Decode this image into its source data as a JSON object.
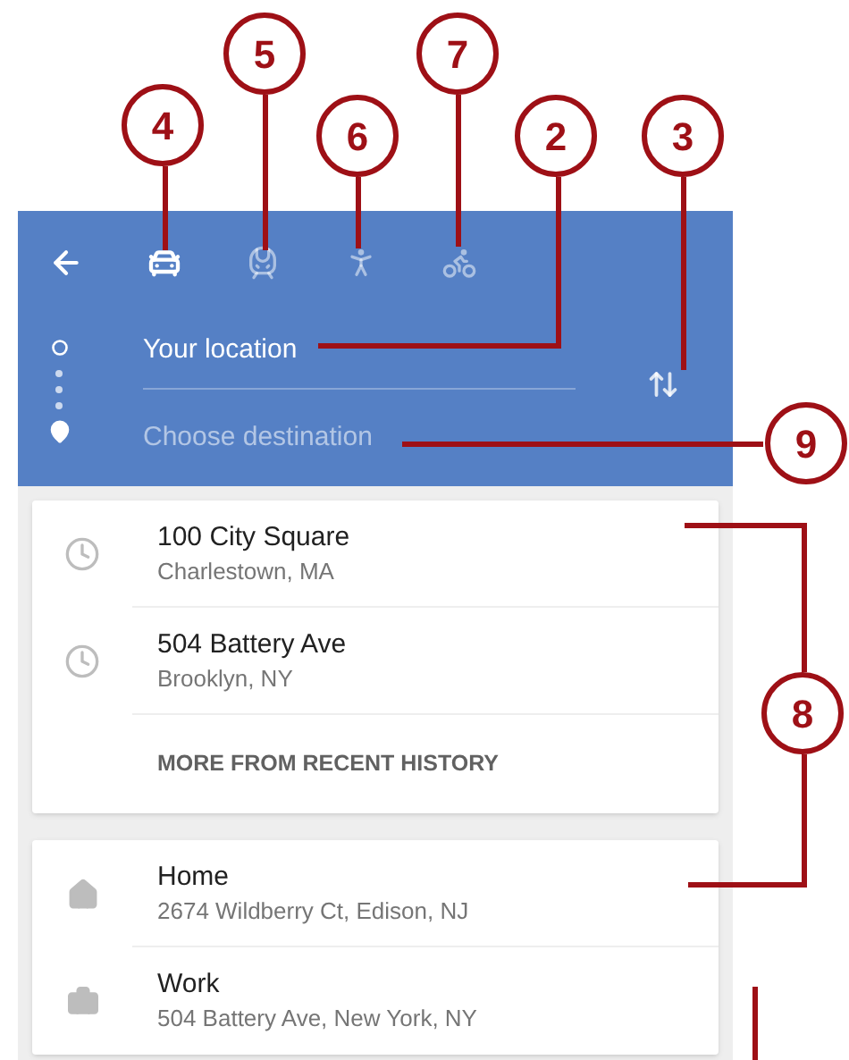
{
  "header": {
    "modes": [
      {
        "kind": "car",
        "selected": true
      },
      {
        "kind": "transit",
        "selected": false
      },
      {
        "kind": "walk",
        "selected": false
      },
      {
        "kind": "bike",
        "selected": false
      }
    ],
    "origin": "Your location",
    "destination": {
      "placeholder": "Choose destination"
    }
  },
  "recent": [
    {
      "title": "100 City Square",
      "subtitle": "Charlestown, MA"
    },
    {
      "title": "504 Battery Ave",
      "subtitle": "Brooklyn, NY"
    }
  ],
  "more_link": "MORE FROM RECENT HISTORY",
  "saved": [
    {
      "kind": "home",
      "title": "Home",
      "subtitle": "2674 Wildberry Ct, Edison, NJ"
    },
    {
      "kind": "work",
      "title": "Work",
      "subtitle": "504 Battery Ave, New York, NY"
    }
  ],
  "callouts": [
    {
      "label": "4"
    },
    {
      "label": "5"
    },
    {
      "label": "6"
    },
    {
      "label": "7"
    },
    {
      "label": "2"
    },
    {
      "label": "3"
    },
    {
      "label": "9"
    },
    {
      "label": "8"
    }
  ]
}
